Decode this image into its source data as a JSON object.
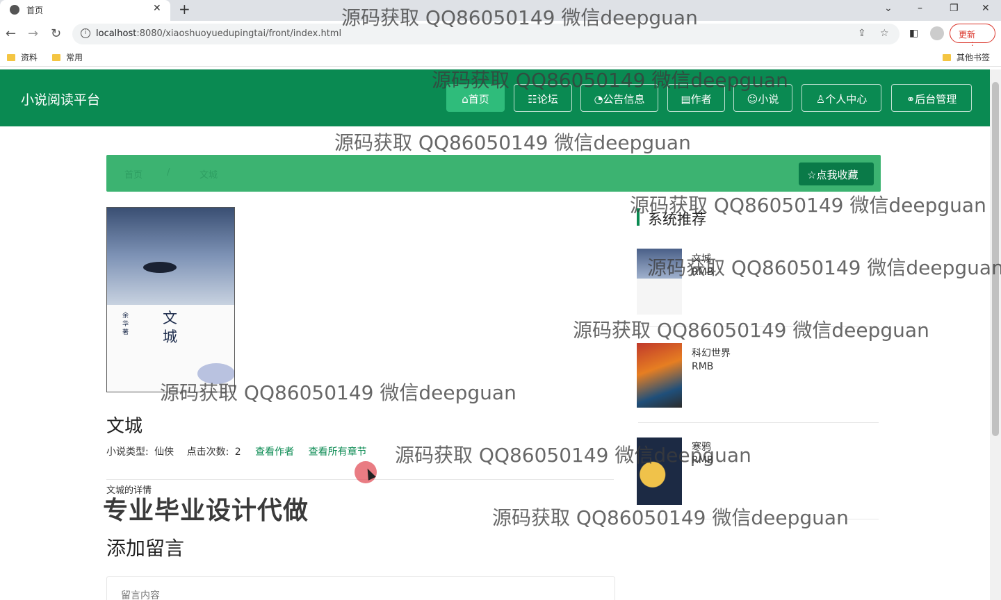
{
  "browser": {
    "tab_title": "首页",
    "tab_close": "✕",
    "new_tab": "+",
    "url_host": "localhost",
    "url_rest": ":8080/xiaoshuoyuedupingtai/front/index.html",
    "update_label": "更新",
    "bookmarks": [
      "资料",
      "常用"
    ],
    "other_bookmarks": "其他书签",
    "icons": [
      "globe-icon",
      "back-icon",
      "forward-icon",
      "reload-icon",
      "info-icon",
      "share-icon",
      "star-icon",
      "sidebar-icon",
      "profile-icon",
      "menu-icon"
    ]
  },
  "site": {
    "title": "小说阅读平台",
    "nav": [
      {
        "icon": "⌂",
        "label": "首页",
        "active": true
      },
      {
        "icon": "☷",
        "label": "论坛",
        "active": false
      },
      {
        "icon": "◔",
        "label": "公告信息",
        "active": false
      },
      {
        "icon": "▤",
        "label": "作者",
        "active": false
      },
      {
        "icon": "☺",
        "label": "小说",
        "active": false
      },
      {
        "icon": "♙",
        "label": "个人中心",
        "active": false
      },
      {
        "icon": "⚭",
        "label": "后台管理",
        "active": false
      }
    ]
  },
  "breadcrumb": {
    "home": "首页",
    "separator": "/",
    "current": "文城",
    "favorite_label": "☆点我收藏"
  },
  "novel": {
    "cover_title": "文城",
    "cover_author": "余华著",
    "title": "文城",
    "type_label": "小说类型:",
    "type_value": "仙侠",
    "clicks_label": "点击次数:",
    "clicks_value": "2",
    "view_author": "查看作者",
    "view_chapters": "查看所有章节",
    "detail_label": "文城的详情"
  },
  "overlay_ad": "专业毕业设计代做",
  "comment": {
    "heading": "添加留言",
    "placeholder": "留言内容"
  },
  "recommend": {
    "heading": "系统推荐",
    "items": [
      {
        "name": "文城",
        "price": "RMB"
      },
      {
        "name": "科幻世界",
        "price": "RMB"
      },
      {
        "name": "寒鸦",
        "price": "RMB"
      }
    ]
  },
  "watermark": "源码获取 QQ86050149 微信deepguan",
  "colors": {
    "header_green": "#0a8a52",
    "nav_active": "#2fbc7b",
    "crumb_bar": "#3cb371",
    "fav_button": "#0a7a48"
  }
}
